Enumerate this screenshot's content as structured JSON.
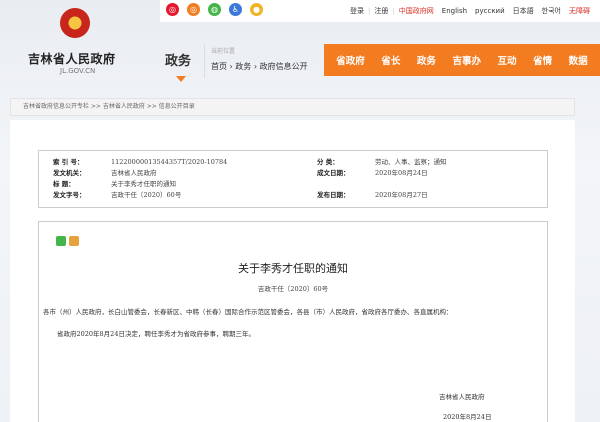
{
  "topbar": {
    "links": [
      "登录",
      "注册",
      "中国政府网",
      "English",
      "русский",
      "日本語",
      "한국어",
      "无障碍"
    ]
  },
  "logo": {
    "name": "吉林省人民政府",
    "domain": "JL.GOV.CN"
  },
  "header": {
    "channel": "政务",
    "location_label": "当前位置",
    "breadcrumb": "首页 › 政务 › 政府信息公开"
  },
  "nav": {
    "items": [
      "省政府",
      "省长",
      "政务",
      "吉事办",
      "互动",
      "省情",
      "数据"
    ]
  },
  "path_bar": "吉林省政府信息公开专栏 >> 吉林省人民政府 >> 信息公开目录",
  "info": {
    "index_label": "索 引 号：",
    "index_value": "11220000013544357T/2020-10784",
    "category_label": "分 类：",
    "category_value": "劳动、人事、监察；通知",
    "issuer_label": "发文机关：",
    "issuer_value": "吉林省人民政府",
    "created_label": "成文日期：",
    "created_value": "2020年08月24日",
    "title_label": "标 题：",
    "title_value": "关于李秀才任职的通知",
    "docno_label": "发文字号：",
    "docno_value": "吉政干任〔2020〕60号",
    "published_label": "发布日期：",
    "published_value": "2020年08月27日"
  },
  "document": {
    "title": "关于李秀才任职的通知",
    "number": "吉政干任〔2020〕60号",
    "recipients": "各市（州）人民政府，长白山管委会，长春新区、中韩（长春）国际合作示范区管委会，各县（市）人民政府，省政府各厅委办、各直属机构：",
    "body": "省政府2020年8月24日决定，聘任李秀才为省政府参事，聘期三年。",
    "signature": "吉林省人民政府",
    "date": "2020年8月24日"
  }
}
